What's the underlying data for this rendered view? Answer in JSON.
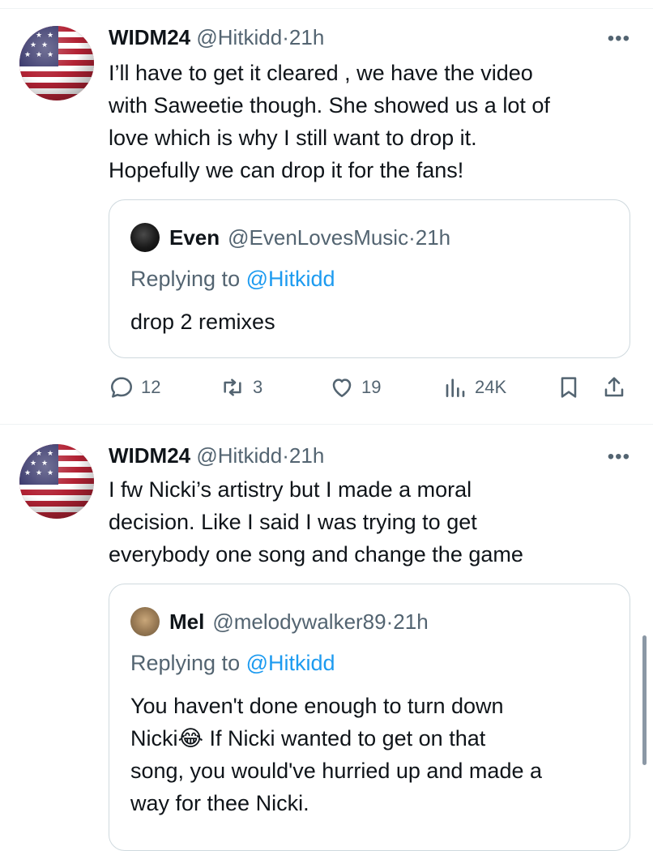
{
  "tweets": [
    {
      "author": "WIDM24",
      "handle": "@Hitkidd",
      "time": "21h",
      "text_lines": [
        "I’ll have to get it cleared , we have the video",
        "with Saweetie though. She showed us a lot of",
        "love which is why I still want to drop it.",
        "Hopefully we can drop it for the fans!"
      ],
      "quote": {
        "author": "Even",
        "handle": "@EvenLovesMusic",
        "time": "21h",
        "replying_label": "Replying to",
        "replying_handle": "@Hitkidd",
        "text_lines": [
          "drop 2 remixes"
        ]
      },
      "actions": {
        "replies": "12",
        "retweets": "3",
        "likes": "19",
        "views": "24K"
      }
    },
    {
      "author": "WIDM24",
      "handle": "@Hitkidd",
      "time": "21h",
      "text_lines": [
        "I fw Nicki’s artistry but I made a moral",
        "decision. Like I said I was trying to get",
        "everybody one song and change the game"
      ],
      "quote": {
        "author": "Mel",
        "handle": "@melodywalker89",
        "time": "21h",
        "replying_label": "Replying to",
        "replying_handle": "@Hitkidd",
        "text_lines": [
          "You haven't done enough to turn down",
          "Nicki😂 If Nicki wanted to get on that",
          "song, you would've hurried up and made a",
          "way for thee Nicki."
        ]
      }
    }
  ],
  "separator": "·",
  "more_glyph": "•••",
  "icons": [
    "flag-avatar",
    "reply-icon",
    "retweet-icon",
    "like-icon",
    "views-icon",
    "bookmark-icon",
    "share-icon"
  ]
}
